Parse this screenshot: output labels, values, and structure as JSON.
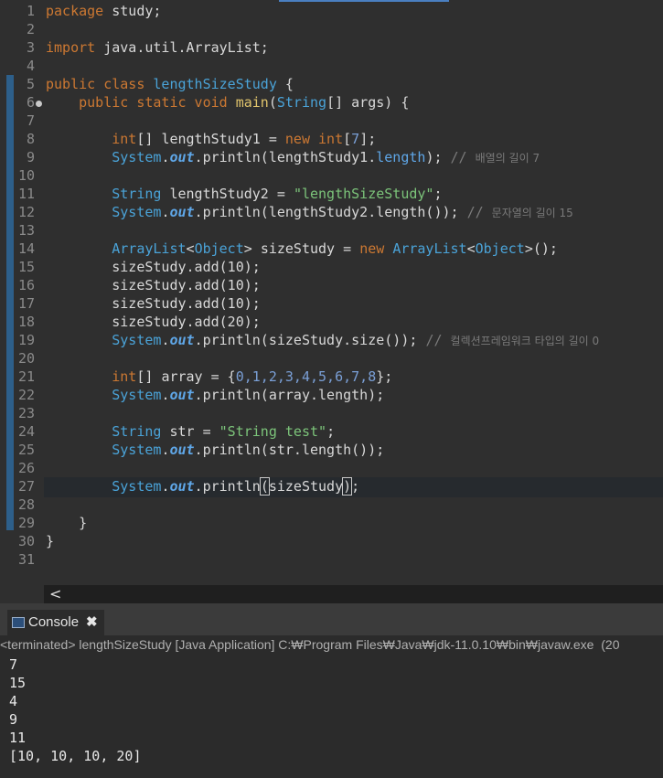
{
  "editor": {
    "line_numbers": [
      "1",
      "2",
      "3",
      "4",
      "5",
      "6",
      "7",
      "8",
      "9",
      "10",
      "11",
      "12",
      "13",
      "14",
      "15",
      "16",
      "17",
      "18",
      "19",
      "20",
      "21",
      "22",
      "23",
      "24",
      "25",
      "26",
      "27",
      "28",
      "29",
      "30",
      "31"
    ],
    "code": {
      "l1_kw": "package",
      "l1_rest": " study;",
      "l3_kw": "import",
      "l3_rest": " java.util.ArrayList;",
      "l5_kw": "public class",
      "l5_name": "lengthSizeStudy",
      "l5_rest": " {",
      "l6_kw": "    public static void",
      "l6_name": "main",
      "l6_p1": "(",
      "l6_type": "String",
      "l6_p2": "[] ",
      "l6_arg": "args",
      "l6_p3": ") {",
      "l8_type": "        int",
      "l8_p1": "[] ",
      "l8_var": "lengthStudy1",
      "l8_p2": " = ",
      "l8_new": "new",
      "l8_sp": " ",
      "l8_int": "int",
      "l8_p3": "[",
      "l8_num": "7",
      "l8_p4": "];",
      "l9_sys": "        System",
      "l9_dot": ".",
      "l9_out": "out",
      "l9_call": ".println(lengthStudy1.",
      "l9_len": "length",
      "l9_end": "); ",
      "l9_cmt": "// ",
      "l9_kor": "배열의 길이 7",
      "l11_type": "        String",
      "l11_sp": " ",
      "l11_var": "lengthStudy2",
      "l11_eq": " = ",
      "l11_str": "\"lengthSizeStudy\"",
      "l11_end": ";",
      "l12_sys": "        System",
      "l12_dot": ".",
      "l12_out": "out",
      "l12_call": ".println(lengthStudy2.length()); ",
      "l12_cmt": "// ",
      "l12_kor": "문자열의 길이 15",
      "l14_type": "        ArrayList",
      "l14_lt": "<",
      "l14_obj": "Object",
      "l14_gt": "> ",
      "l14_var": "sizeStudy",
      "l14_eq": " = ",
      "l14_new": "new",
      "l14_sp": " ",
      "l14_type2": "ArrayList",
      "l14_lt2": "<",
      "l14_obj2": "Object",
      "l14_end": ">();",
      "l15": "        sizeStudy.add(10);",
      "l16": "        sizeStudy.add(10);",
      "l17": "        sizeStudy.add(10);",
      "l18": "        sizeStudy.add(20);",
      "l19_sys": "        System",
      "l19_dot": ".",
      "l19_out": "out",
      "l19_call": ".println(sizeStudy.size()); ",
      "l19_cmt": "// ",
      "l19_kor": "컬렉션프레임워크 타입의 길이 0",
      "l21_type": "        int",
      "l21_p1": "[] ",
      "l21_var": "array",
      "l21_eq": " = {",
      "l21_nums": "0,1,2,3,4,5,6,7,8",
      "l21_end": "};",
      "l22_sys": "        System",
      "l22_dot": ".",
      "l22_out": "out",
      "l22_call": ".println(array.length);",
      "l24_type": "        String",
      "l24_sp": " ",
      "l24_var": "str",
      "l24_eq": " = ",
      "l24_str": "\"String test\"",
      "l24_end": ";",
      "l25_sys": "        System",
      "l25_dot": ".",
      "l25_out": "out",
      "l25_call": ".println(str.length());",
      "l27_sys": "        System",
      "l27_dot": ".",
      "l27_out": "out",
      "l27_call": ".println",
      "l27_open": "(",
      "l27_arg": "sizeStudy",
      "l27_close": ")",
      "l27_end": ";",
      "l29": "    }",
      "l30": "}"
    },
    "hscroll_arrow": "<"
  },
  "console": {
    "tab_label": "Console",
    "close_glyph": "✖",
    "status": "<terminated> lengthSizeStudy [Java Application] C:₩Program Files₩Java₩jdk-11.0.10₩bin₩javaw.exe  (20",
    "output": [
      "7",
      "15",
      "4",
      "9",
      "11",
      "[10, 10, 10, 20]"
    ]
  },
  "colors": {
    "keyword": "#cc7832",
    "type": "#4aa3d8",
    "string": "#7cc47a",
    "number": "#7a9fd6",
    "comment": "#7a7a7a"
  }
}
